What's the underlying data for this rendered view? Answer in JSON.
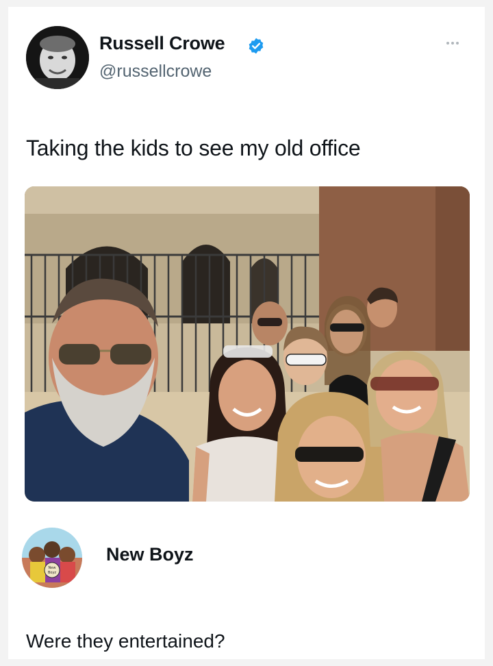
{
  "tweet": {
    "author_name": "Russell Crowe",
    "author_handle": "@russellcrowe",
    "verified": true,
    "text": "Taking the kids to see my old office",
    "photo_subject": "group-selfie-at-colosseum"
  },
  "reply": {
    "author_name": "New Boyz",
    "avatar_label": "New Boyz",
    "text": "Were they entertained?"
  },
  "icons": {
    "verified": "verified-badge-icon",
    "more": "more-options-icon"
  },
  "colors": {
    "verified_blue": "#1d9bf0",
    "handle_gray": "#536471",
    "text": "#0f1419"
  }
}
